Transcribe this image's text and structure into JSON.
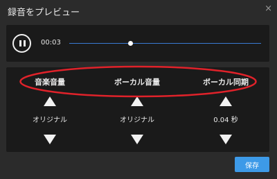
{
  "dialog": {
    "title": "録音をプレビュー",
    "close_glyph": "×"
  },
  "player": {
    "time": "00:03",
    "progress": 0.32,
    "accent": "#3a7bd5"
  },
  "settings": [
    {
      "label": "音楽音量",
      "value": "オリジナル"
    },
    {
      "label": "ボーカル音量",
      "value": "オリジナル"
    },
    {
      "label": "ボーカル同期",
      "value": "0.04 秒"
    }
  ],
  "annotation": {
    "shape": "ellipse",
    "color": "#e0222a"
  },
  "footer": {
    "save_label": "保存",
    "save_color": "#3d9ae8"
  }
}
